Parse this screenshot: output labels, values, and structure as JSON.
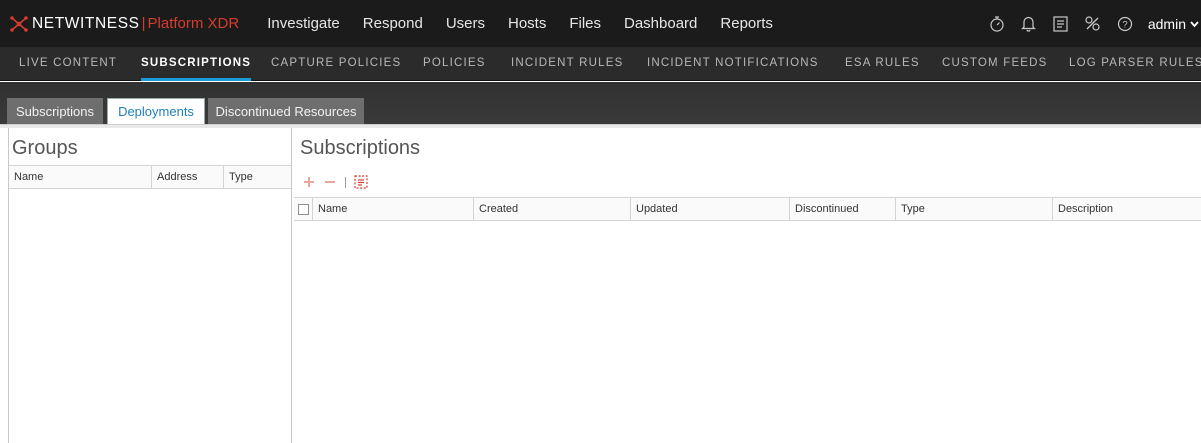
{
  "app": {
    "brand_name": "NETWITNESS",
    "brand_separator": "|",
    "brand_product": "Platform XDR",
    "colors": {
      "accent": "#1a9bd7",
      "brand_red": "#d53c2e",
      "topbar": "#1b1b1b"
    }
  },
  "main_nav": [
    "Investigate",
    "Respond",
    "Users",
    "Hosts",
    "Files",
    "Dashboard",
    "Reports"
  ],
  "top_icons": [
    "timer-icon",
    "bell-icon",
    "checklist-icon",
    "tools-icon",
    "help-icon"
  ],
  "user": {
    "name": "admin"
  },
  "sub_nav": {
    "items": [
      "LIVE CONTENT",
      "SUBSCRIPTIONS",
      "CAPTURE POLICIES",
      "POLICIES",
      "INCIDENT RULES",
      "INCIDENT NOTIFICATIONS",
      "ESA RULES",
      "CUSTOM FEEDS",
      "LOG PARSER RULES"
    ],
    "active": "SUBSCRIPTIONS"
  },
  "tabs": {
    "items": [
      "Subscriptions",
      "Deployments",
      "Discontinued Resources"
    ],
    "active": "Deployments"
  },
  "groups_panel": {
    "title": "Groups",
    "columns": [
      "Name",
      "Address",
      "Type"
    ],
    "rows": []
  },
  "subscriptions_panel": {
    "title": "Subscriptions",
    "toolbar": [
      "add-icon",
      "remove-icon",
      "details-icon"
    ],
    "columns": [
      "Name",
      "Created",
      "Updated",
      "Discontinued",
      "Type",
      "Description"
    ],
    "rows": []
  }
}
